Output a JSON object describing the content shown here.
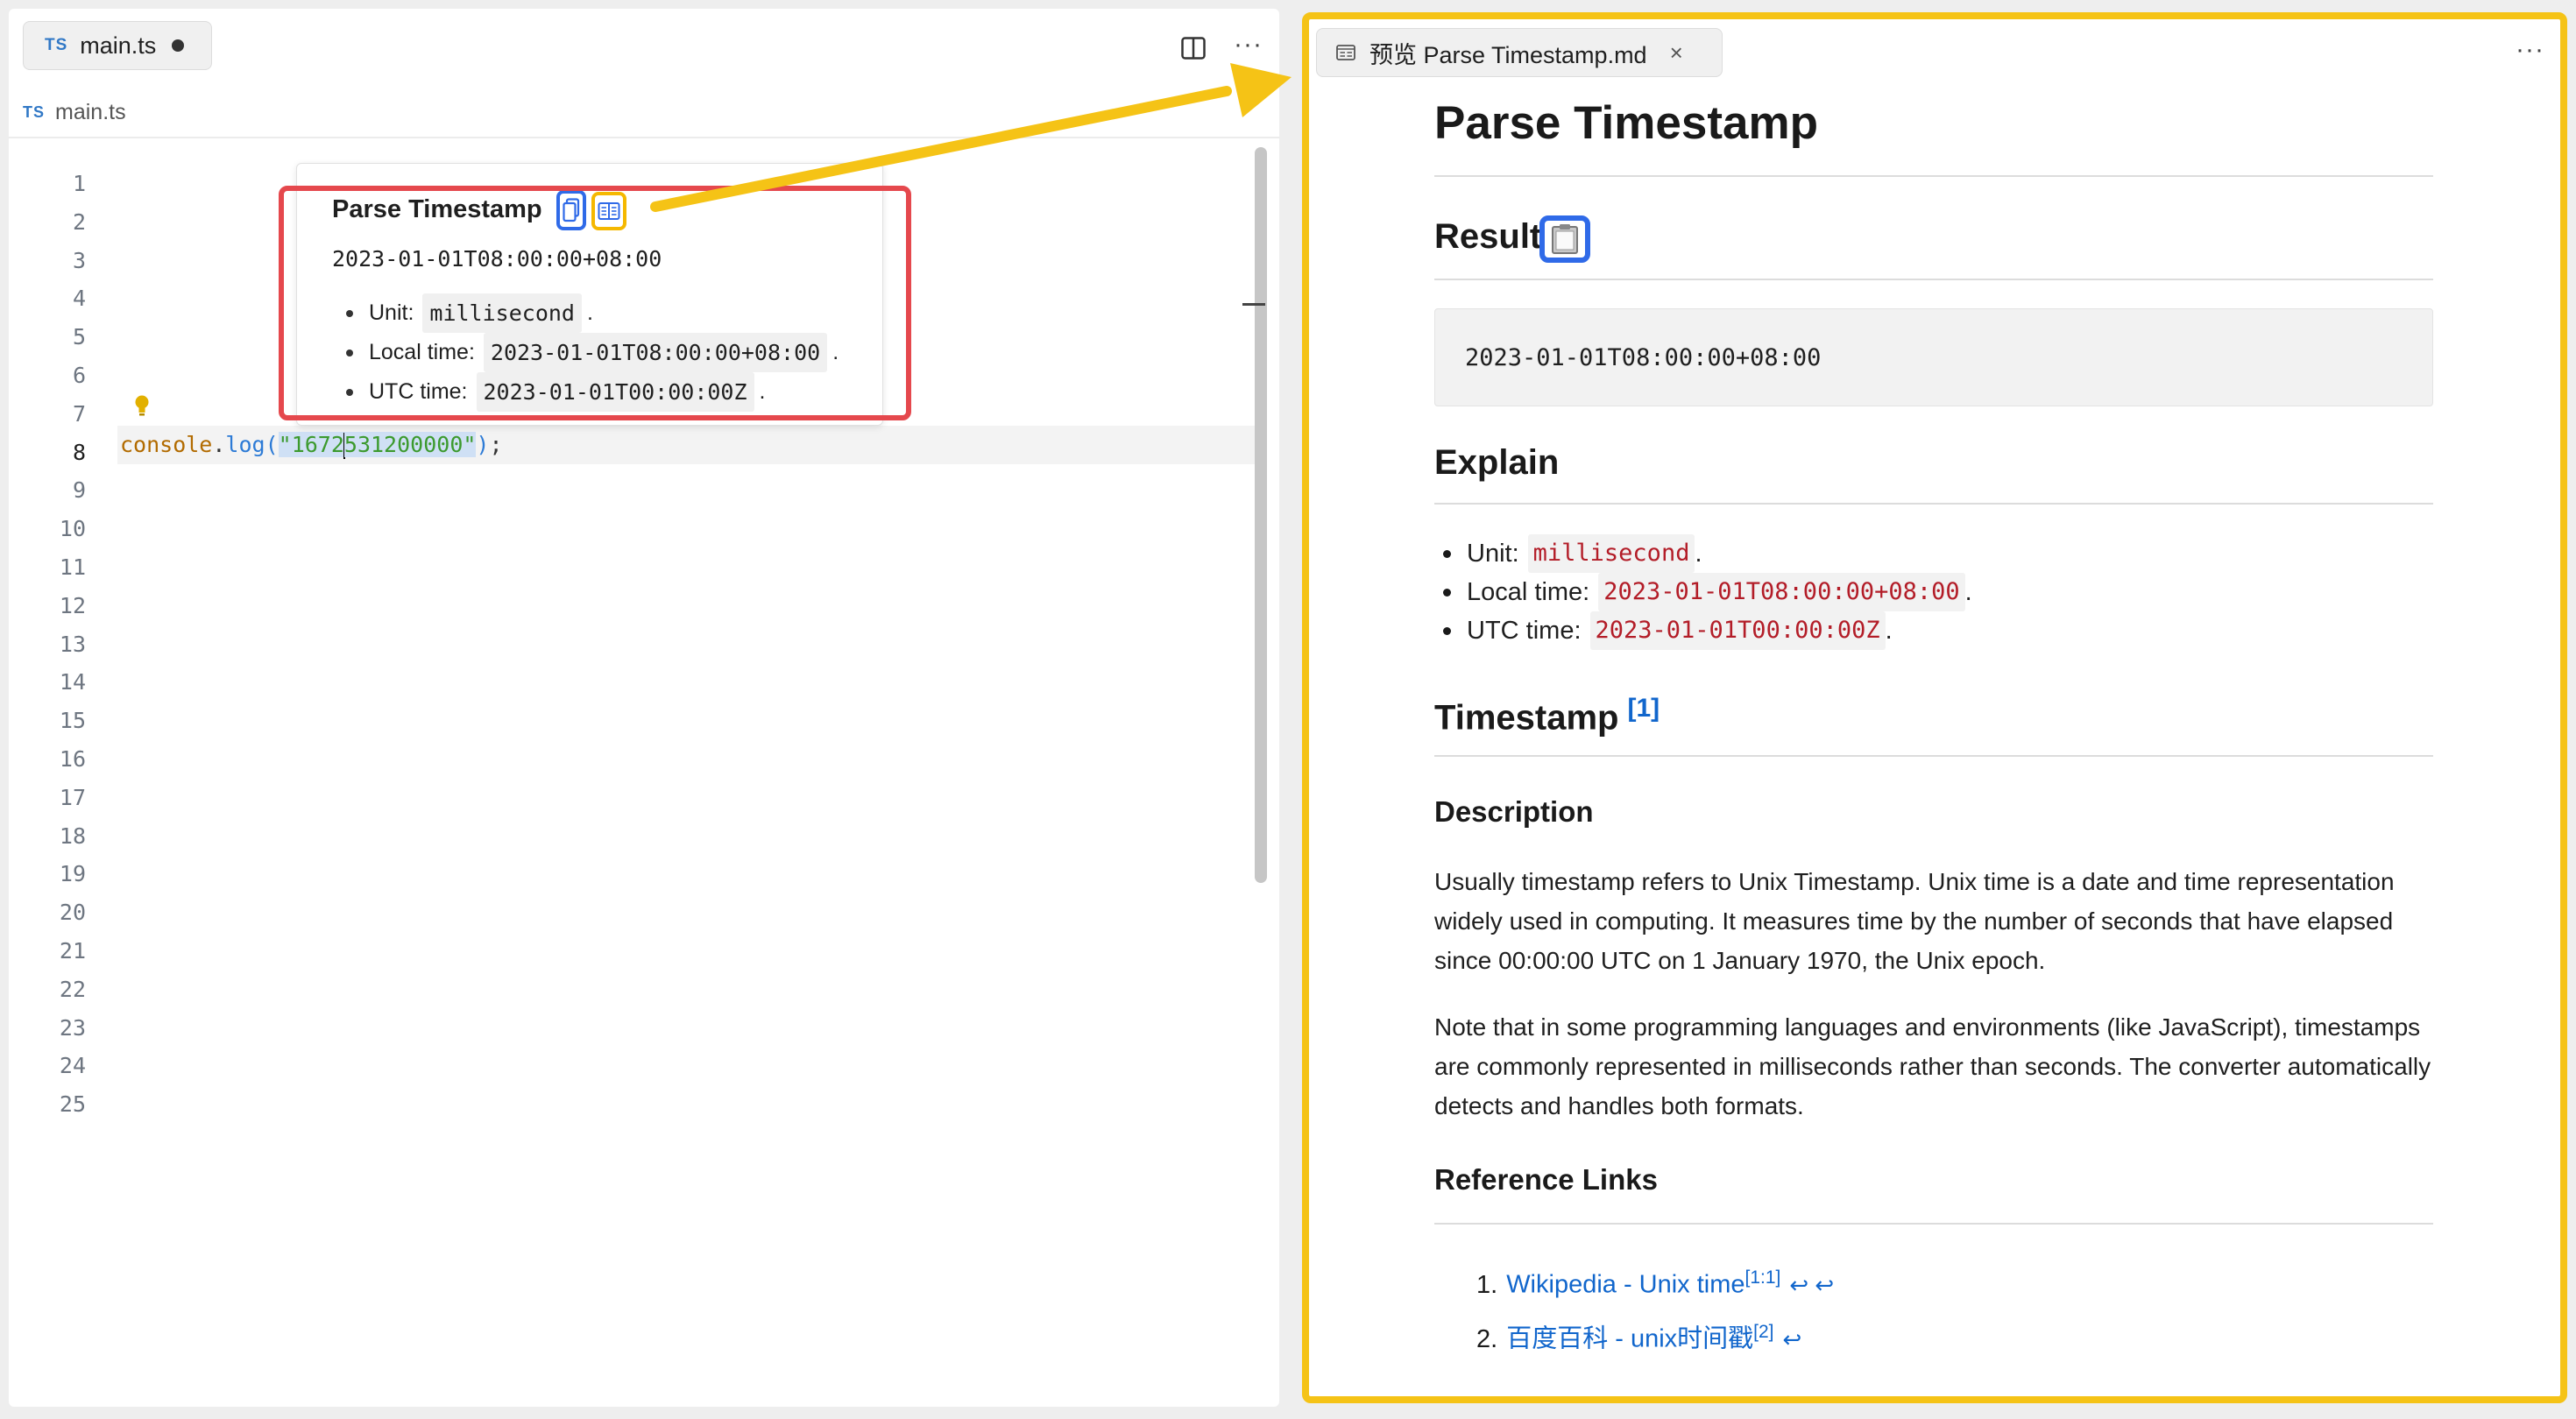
{
  "editor": {
    "tab": {
      "icon": "TS",
      "label": "main.ts"
    },
    "breadcrumb": {
      "icon": "TS",
      "label": "main.ts"
    },
    "line_numbers": [
      "1",
      "2",
      "3",
      "4",
      "5",
      "6",
      "7",
      "8",
      "9",
      "10",
      "11",
      "12",
      "13",
      "14",
      "15",
      "16",
      "17",
      "18",
      "19",
      "20",
      "21",
      "22",
      "23",
      "24",
      "25"
    ],
    "active_line": "8",
    "code": {
      "object": "console",
      "dot": ".",
      "method": "log",
      "open_paren": "(",
      "string_before_cursor": "\"1672",
      "string_after_cursor": "531200000\"",
      "close_paren": ")",
      "semicolon": ";"
    }
  },
  "hover": {
    "title": "Parse Timestamp",
    "result": "2023-01-01T08:00:00+08:00",
    "items": [
      {
        "label": "Unit:",
        "code": "millisecond",
        "suffix": "."
      },
      {
        "label": "Local time:",
        "code": "2023-01-01T08:00:00+08:00",
        "suffix": "."
      },
      {
        "label": "UTC time:",
        "code": "2023-01-01T00:00:00Z",
        "suffix": "."
      }
    ]
  },
  "preview": {
    "tab": {
      "label": "预览 Parse Timestamp.md",
      "close": "×"
    },
    "h1": "Parse Timestamp",
    "result_heading": "Result",
    "result_code": "2023-01-01T08:00:00+08:00",
    "explain_heading": "Explain",
    "explain_items": [
      {
        "label": "Unit:",
        "code": "millisecond",
        "suffix": "."
      },
      {
        "label": "Local time:",
        "code": "2023-01-01T08:00:00+08:00",
        "suffix": "."
      },
      {
        "label": "UTC time:",
        "code": "2023-01-01T00:00:00Z",
        "suffix": "."
      }
    ],
    "timestamp_heading": "Timestamp",
    "timestamp_ref": "[1]",
    "description_heading": "Description",
    "description_p1": "Usually timestamp refers to Unix Timestamp. Unix time is a date and time representation widely used in computing. It measures time by the number of seconds that have elapsed since 00:00:00 UTC on 1 January 1970, the Unix epoch.",
    "description_p2": "Note that in some programming languages and environments (like JavaScript), timestamps are commonly represented in milliseconds rather than seconds. The converter automatically detects and handles both formats.",
    "references_heading": "Reference Links",
    "references": [
      {
        "num": "1.",
        "text": "Wikipedia - Unix time",
        "sup": "[1:1]",
        "back": "↩ ↩"
      },
      {
        "num": "2.",
        "text": "百度百科 - unix时间戳",
        "sup": "[2]",
        "back": "↩"
      }
    ]
  },
  "colors": {
    "highlight_red": "#e5484d",
    "highlight_blue": "#2f6ae8",
    "highlight_yellow": "#f5c316"
  }
}
